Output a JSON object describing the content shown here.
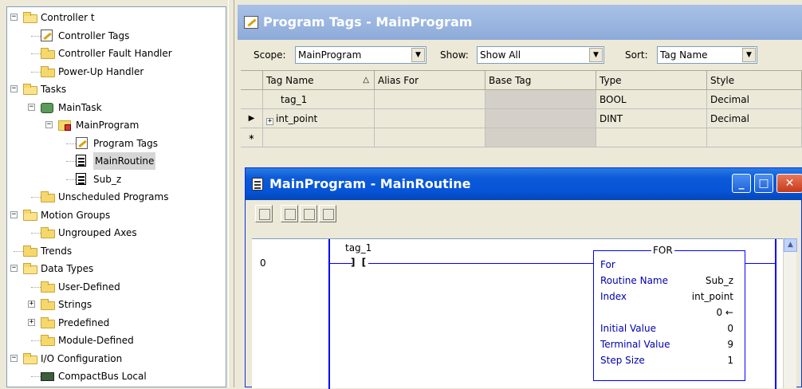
{
  "tree": {
    "items": [
      {
        "label": "Controller t",
        "level": 0,
        "expander": "−",
        "icon": "folder-icon"
      },
      {
        "label": "Controller Tags",
        "level": 1,
        "icon": "tags-icon"
      },
      {
        "label": "Controller Fault Handler",
        "level": 1,
        "icon": "folder-icon"
      },
      {
        "label": "Power-Up Handler",
        "level": 1,
        "icon": "folder-icon"
      },
      {
        "label": "Tasks",
        "level": 0,
        "expander": "−",
        "icon": "folder-icon"
      },
      {
        "label": "MainTask",
        "level": 1,
        "expander": "−",
        "icon": "task-icon"
      },
      {
        "label": "MainProgram",
        "level": 2,
        "expander": "−",
        "icon": "program-icon"
      },
      {
        "label": "Program Tags",
        "level": 3,
        "icon": "tags-icon"
      },
      {
        "label": "MainRoutine",
        "level": 3,
        "icon": "routine-icon",
        "selected": true
      },
      {
        "label": "Sub_z",
        "level": 3,
        "icon": "routine-icon"
      },
      {
        "label": "Unscheduled Programs",
        "level": 1,
        "icon": "folder-icon"
      },
      {
        "label": "Motion Groups",
        "level": 0,
        "expander": "−",
        "icon": "folder-icon"
      },
      {
        "label": "Ungrouped Axes",
        "level": 1,
        "icon": "folder-icon"
      },
      {
        "label": "Trends",
        "level": 0,
        "icon": "folder-icon"
      },
      {
        "label": "Data Types",
        "level": 0,
        "expander": "−",
        "icon": "folder-icon"
      },
      {
        "label": "User-Defined",
        "level": 1,
        "icon": "datatype-icon"
      },
      {
        "label": "Strings",
        "level": 1,
        "expander": "+",
        "icon": "datatype-icon"
      },
      {
        "label": "Predefined",
        "level": 1,
        "expander": "+",
        "icon": "datatype-icon"
      },
      {
        "label": "Module-Defined",
        "level": 1,
        "icon": "datatype-icon"
      },
      {
        "label": "I/O Configuration",
        "level": 0,
        "expander": "−",
        "icon": "folder-icon"
      },
      {
        "label": "CompactBus Local",
        "level": 1,
        "icon": "bus-icon"
      }
    ]
  },
  "tags_window": {
    "title": "Program Tags - MainProgram",
    "scope_label": "Scope:",
    "scope_value": "MainProgram",
    "show_label": "Show:",
    "show_value": "Show All",
    "sort_label": "Sort:",
    "sort_value": "Tag Name",
    "columns": [
      "Tag Name",
      "Alias For",
      "Base Tag",
      "Type",
      "Style"
    ],
    "sort_indicator": "△",
    "rows": [
      {
        "marker": "",
        "name": "tag_1",
        "alias": "",
        "base": "",
        "type": "BOOL",
        "style": "Decimal",
        "expander": ""
      },
      {
        "marker": "▶",
        "name": "int_point",
        "alias": "",
        "base": "",
        "type": "DINT",
        "style": "Decimal",
        "expander": "+"
      },
      {
        "marker": "∗",
        "name": "",
        "alias": "",
        "base": "",
        "type": "",
        "style": "",
        "expander": ""
      }
    ]
  },
  "routine_window": {
    "title": "MainProgram - MainRoutine",
    "rung_number": "0",
    "contact_tag": "tag_1",
    "contact_symbol": "] [",
    "for_block": {
      "name": "FOR",
      "header": "For",
      "rows": [
        {
          "label": "Routine Name",
          "value": "Sub_z"
        },
        {
          "label": "Index",
          "value": "int_point"
        },
        {
          "label": "",
          "value": "0 ←"
        },
        {
          "label": "Initial Value",
          "value": "0"
        },
        {
          "label": "Terminal Value",
          "value": "9"
        },
        {
          "label": "Step Size",
          "value": "1"
        }
      ]
    }
  }
}
